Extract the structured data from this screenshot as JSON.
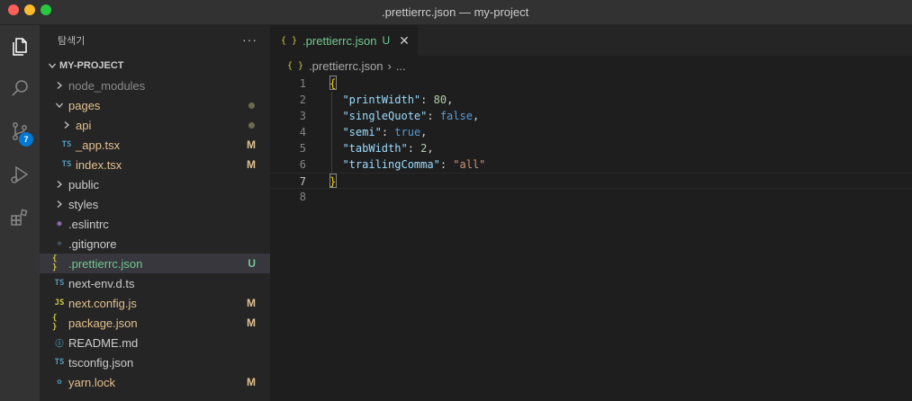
{
  "window": {
    "title": ".prettierrc.json — my-project"
  },
  "colors": {
    "accent": "#0078d4",
    "modified": "#e2c08d",
    "untracked": "#73c991",
    "folder_fill": "#c5a45a"
  },
  "activity": {
    "items": [
      "explorer-icon",
      "search-icon",
      "source-control-icon",
      "run-debug-icon",
      "extensions-icon"
    ],
    "scm_badge": "7"
  },
  "sidebar": {
    "title": "탐색기",
    "more": "···",
    "project": "MY-PROJECT",
    "tree": [
      {
        "label": "node_modules",
        "type": "folder",
        "expanded": false,
        "depth": 1,
        "status": "",
        "color": "#8b8b8b"
      },
      {
        "label": "pages",
        "type": "folder",
        "expanded": true,
        "depth": 1,
        "status": "dot",
        "color": "#e2c08d"
      },
      {
        "label": "api",
        "type": "folder",
        "expanded": false,
        "depth": 2,
        "status": "dot",
        "color": "#e2c08d"
      },
      {
        "label": "_app.tsx",
        "type": "ts",
        "icon": "TS",
        "depth": 2,
        "status": "M",
        "color": "#e2c08d"
      },
      {
        "label": "index.tsx",
        "type": "ts",
        "icon": "TS",
        "depth": 2,
        "status": "M",
        "color": "#e2c08d"
      },
      {
        "label": "public",
        "type": "folder",
        "expanded": false,
        "depth": 1,
        "status": "",
        "color": "#cccccc"
      },
      {
        "label": "styles",
        "type": "folder",
        "expanded": false,
        "depth": 1,
        "status": "",
        "color": "#cccccc"
      },
      {
        "label": ".eslintrc",
        "type": "eslint",
        "icon": "◉",
        "depth": 1,
        "status": "",
        "color": "#cccccc"
      },
      {
        "label": ".gitignore",
        "type": "git",
        "icon": "◆",
        "depth": 1,
        "status": "",
        "color": "#cccccc"
      },
      {
        "label": ".prettierrc.json",
        "type": "json",
        "icon": "{ }",
        "depth": 1,
        "status": "U",
        "color": "#73c991",
        "selected": true
      },
      {
        "label": "next-env.d.ts",
        "type": "ts",
        "icon": "TS",
        "depth": 1,
        "status": "",
        "color": "#cccccc"
      },
      {
        "label": "next.config.js",
        "type": "js",
        "icon": "JS",
        "depth": 1,
        "status": "M",
        "color": "#e2c08d"
      },
      {
        "label": "package.json",
        "type": "json",
        "icon": "{ }",
        "depth": 1,
        "status": "M",
        "color": "#e2c08d"
      },
      {
        "label": "README.md",
        "type": "info",
        "icon": "ⓘ",
        "depth": 1,
        "status": "",
        "color": "#cccccc"
      },
      {
        "label": "tsconfig.json",
        "type": "tsconfig",
        "icon": "TS",
        "depth": 1,
        "status": "",
        "color": "#cccccc"
      },
      {
        "label": "yarn.lock",
        "type": "yarn",
        "icon": "✿",
        "depth": 1,
        "status": "M",
        "color": "#e2c08d"
      }
    ]
  },
  "editor": {
    "tab": {
      "icon": "{ }",
      "label": ".prettierrc.json",
      "status": "U",
      "close": "✕"
    },
    "breadcrumb": {
      "icon": "{ }",
      "file": ".prettierrc.json",
      "sep": "›",
      "more": "..."
    },
    "current_line": 7,
    "lines": [
      {
        "num": "1",
        "tokens": [
          [
            "br",
            "{"
          ]
        ]
      },
      {
        "num": "2",
        "tokens": [
          [
            "p",
            "  "
          ],
          [
            "k",
            "\"printWidth\""
          ],
          [
            "p",
            ": "
          ],
          [
            "n",
            "80"
          ],
          [
            "p",
            ","
          ]
        ]
      },
      {
        "num": "3",
        "tokens": [
          [
            "p",
            "  "
          ],
          [
            "k",
            "\"singleQuote\""
          ],
          [
            "p",
            ": "
          ],
          [
            "b",
            "false"
          ],
          [
            "p",
            ","
          ]
        ]
      },
      {
        "num": "4",
        "tokens": [
          [
            "p",
            "  "
          ],
          [
            "k",
            "\"semi\""
          ],
          [
            "p",
            ": "
          ],
          [
            "b",
            "true"
          ],
          [
            "p",
            ","
          ]
        ]
      },
      {
        "num": "5",
        "tokens": [
          [
            "p",
            "  "
          ],
          [
            "k",
            "\"tabWidth\""
          ],
          [
            "p",
            ": "
          ],
          [
            "n",
            "2"
          ],
          [
            "p",
            ","
          ]
        ]
      },
      {
        "num": "6",
        "tokens": [
          [
            "p",
            "  "
          ],
          [
            "k",
            "\"trailingComma\""
          ],
          [
            "p",
            ": "
          ],
          [
            "s",
            "\"all\""
          ]
        ]
      },
      {
        "num": "7",
        "tokens": [
          [
            "br",
            "}"
          ]
        ]
      },
      {
        "num": "8",
        "tokens": []
      }
    ]
  }
}
